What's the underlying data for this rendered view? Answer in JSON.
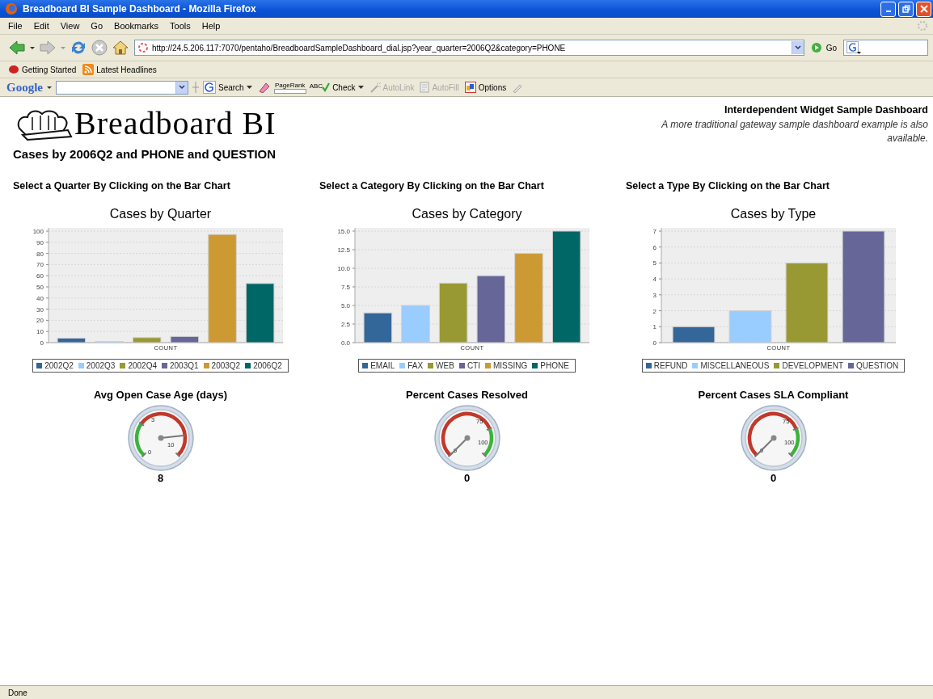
{
  "window": {
    "title": "Breadboard BI Sample Dashboard - Mozilla Firefox"
  },
  "menu": [
    "File",
    "Edit",
    "View",
    "Go",
    "Bookmarks",
    "Tools",
    "Help"
  ],
  "navigation": {
    "url": "http://24.5.206.117:7070/pentaho/BreadboardSampleDashboard_dial.jsp?year_quarter=2006Q2&category=PHONE",
    "go_label": "Go"
  },
  "bookmarks": [
    "Getting Started",
    "Latest Headlines"
  ],
  "google_toolbar": {
    "logo": "Google",
    "pagerank_label": "PageRank",
    "items": [
      {
        "kind": "search",
        "label": "Search",
        "disabled": false,
        "dropdown": true
      },
      {
        "kind": "check",
        "label": "Check",
        "badge": "ABC",
        "disabled": false,
        "dropdown": true
      },
      {
        "kind": "autolink",
        "label": "AutoLink",
        "disabled": true,
        "dropdown": false
      },
      {
        "kind": "autofill",
        "label": "AutoFill",
        "disabled": true,
        "dropdown": false
      },
      {
        "kind": "options",
        "label": "Options",
        "disabled": false,
        "dropdown": false
      }
    ]
  },
  "page": {
    "logo": "Breadboard BI",
    "header_title": "Interdependent Widget Sample Dashboard",
    "header_note": "A more traditional gateway sample dashboard example is also available.",
    "heading": "Cases by 2006Q2 and PHONE and QUESTION",
    "panels": [
      {
        "prompt": "Select a Quarter By Clicking on the Bar Chart",
        "chart_data": {
          "type": "bar",
          "title": "Cases by Quarter",
          "grid": true,
          "categories": [
            "COUNT"
          ],
          "ylim": [
            0,
            100
          ],
          "yticks": [
            0,
            10,
            20,
            30,
            40,
            50,
            60,
            70,
            80,
            90,
            100
          ],
          "series": [
            {
              "name": "2002Q2",
              "color": "#336699",
              "values": [
                4
              ]
            },
            {
              "name": "2002Q3",
              "color": "#99ccff",
              "values": [
                1
              ]
            },
            {
              "name": "2002Q4",
              "color": "#999933",
              "values": [
                4.5
              ]
            },
            {
              "name": "2003Q1",
              "color": "#666699",
              "values": [
                5.5
              ]
            },
            {
              "name": "2003Q2",
              "color": "#cc9933",
              "values": [
                97
              ]
            },
            {
              "name": "2006Q2",
              "color": "#006666",
              "values": [
                53
              ]
            }
          ]
        },
        "gauge": {
          "title": "Avg Open Case Age (days)",
          "kind": "low_good",
          "labels": [
            "3",
            "0",
            "10"
          ],
          "value": "8"
        }
      },
      {
        "prompt": "Select a Category By Clicking on the Bar Chart",
        "chart_data": {
          "type": "bar",
          "title": "Cases by Category",
          "grid": true,
          "categories": [
            "COUNT"
          ],
          "ylim": [
            0,
            15
          ],
          "yticks": [
            {
              "value": 0,
              "label": "0.0"
            },
            {
              "value": 2.5,
              "label": "2.5"
            },
            {
              "value": 5,
              "label": "5.0"
            },
            {
              "value": 7.5,
              "label": "7.5"
            },
            {
              "value": 10,
              "label": "10.0"
            },
            {
              "value": 12.5,
              "label": "12.5"
            },
            {
              "value": 15,
              "label": "15.0"
            }
          ],
          "series": [
            {
              "name": "EMAIL",
              "color": "#336699",
              "values": [
                4
              ]
            },
            {
              "name": "FAX",
              "color": "#99ccff",
              "values": [
                5
              ]
            },
            {
              "name": "WEB",
              "color": "#999933",
              "values": [
                8
              ]
            },
            {
              "name": "CTI",
              "color": "#666699",
              "values": [
                9
              ]
            },
            {
              "name": "MISSING",
              "color": "#cc9933",
              "values": [
                12
              ]
            },
            {
              "name": "PHONE",
              "color": "#006666",
              "values": [
                15
              ]
            }
          ]
        },
        "gauge": {
          "title": "Percent Cases Resolved",
          "kind": "high_good",
          "labels": [
            "75",
            "100",
            "0"
          ],
          "value": "0"
        }
      },
      {
        "prompt": "Select a Type By Clicking on the Bar Chart",
        "chart_data": {
          "type": "bar",
          "title": "Cases by Type",
          "grid": true,
          "categories": [
            "COUNT"
          ],
          "ylim": [
            0,
            7
          ],
          "yticks": [
            0,
            1,
            2,
            3,
            4,
            5,
            6,
            7
          ],
          "series": [
            {
              "name": "REFUND",
              "color": "#336699",
              "values": [
                1
              ]
            },
            {
              "name": "MISCELLANEOUS",
              "color": "#99ccff",
              "values": [
                2
              ]
            },
            {
              "name": "DEVELOPMENT",
              "color": "#999933",
              "values": [
                5
              ]
            },
            {
              "name": "QUESTION",
              "color": "#666699",
              "values": [
                7
              ]
            }
          ]
        },
        "gauge": {
          "title": "Percent Cases SLA Compliant",
          "kind": "high_good",
          "labels": [
            "75",
            "100",
            "0"
          ],
          "value": "0"
        }
      }
    ]
  },
  "status": "Done"
}
